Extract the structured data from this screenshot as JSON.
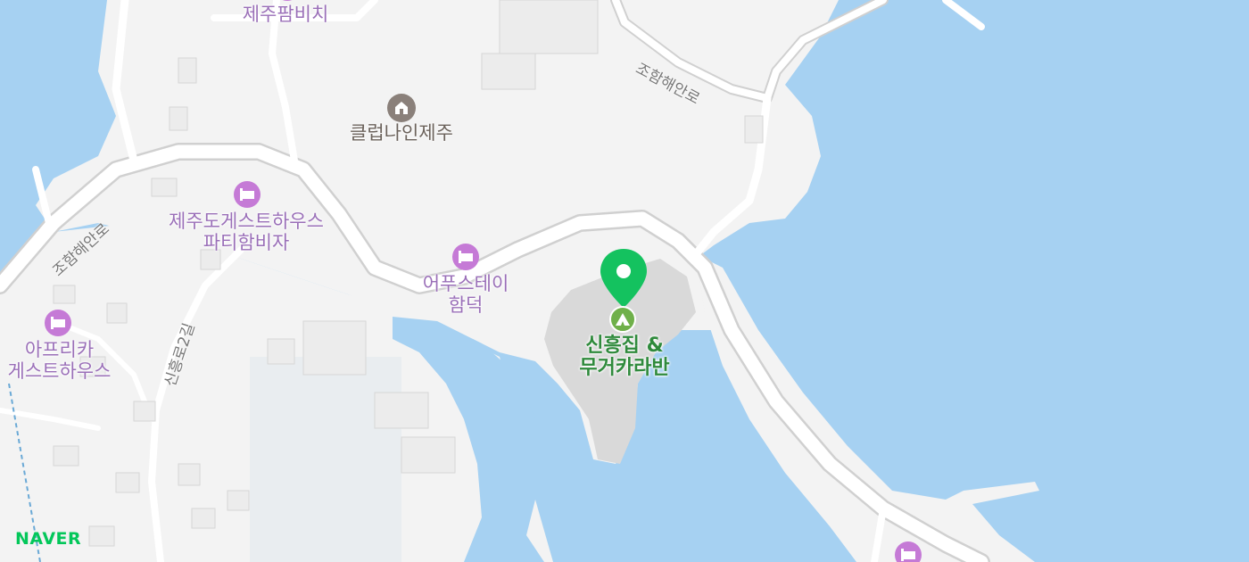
{
  "map": {
    "colors": {
      "water": "#a6d1f2",
      "land": "#f3f3f3",
      "road": "#ffffff",
      "road_edge": "#d9d9d9",
      "poi": "#c57ad6",
      "marker": "#14c25f",
      "brand": "#03c75a"
    },
    "labels": {
      "poi_top": "제주팜비치",
      "club": "클럽나인제주",
      "road_jo_right": "조함해안로",
      "road_jo_left": "조함해안로",
      "guesthouse_1": "제주도게스트하우스",
      "guesthouse_1b": "파티함비자",
      "upstay_1": "어푸스테이",
      "upstay_2": "함덕",
      "dest_1": "신흥집 &",
      "dest_2": "무거카라반",
      "africa_1": "아프리카",
      "africa_2": "게스트하우스",
      "road_sinheung": "신흥로2길"
    },
    "icons": [
      "lodging-icon",
      "building-icon",
      "camping-icon",
      "location-pin-icon"
    ],
    "brand": {
      "logo": "NAVER"
    }
  }
}
